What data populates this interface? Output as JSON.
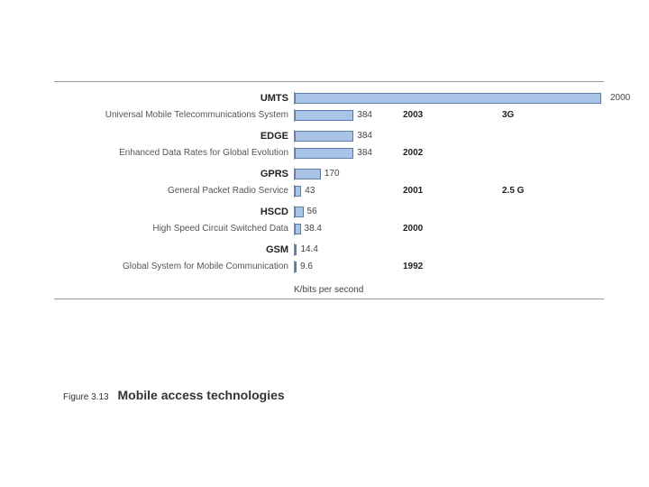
{
  "chart_data": {
    "type": "bar",
    "title": "Mobile access technologies",
    "xlabel": "K/bits per second",
    "ylabel": "",
    "xlim": [
      0,
      2000
    ],
    "series": [
      {
        "abbr": "UMTS",
        "full": "Universal Mobile Telecommunications System",
        "values": [
          {
            "v": 2000
          },
          {
            "v": 384,
            "year": "2003",
            "gen": "3G"
          }
        ]
      },
      {
        "abbr": "EDGE",
        "full": "Enhanced Data Rates for Global Evolution",
        "values": [
          {
            "v": 384
          },
          {
            "v": 384,
            "year": "2002"
          }
        ]
      },
      {
        "abbr": "GPRS",
        "full": "General Packet Radio Service",
        "values": [
          {
            "v": 170
          },
          {
            "v": 43,
            "year": "2001",
            "gen": "2.5 G"
          }
        ]
      },
      {
        "abbr": "HSCD",
        "full": "High Speed Circuit Switched Data",
        "values": [
          {
            "v": 56
          },
          {
            "v": 38.4,
            "year": "2000"
          }
        ]
      },
      {
        "abbr": "GSM",
        "full": "Global System for Mobile Communication",
        "values": [
          {
            "v": 14.4
          },
          {
            "v": 9.6,
            "year": "1992"
          }
        ]
      }
    ]
  },
  "caption": {
    "fignum": "Figure 3.13",
    "title": "Mobile access technologies"
  },
  "xlabel": "K/bits per second"
}
